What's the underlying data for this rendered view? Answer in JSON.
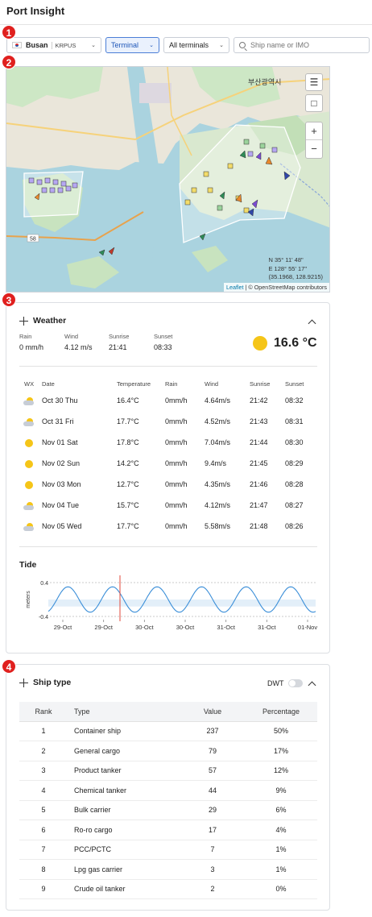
{
  "page": {
    "title": "Port Insight"
  },
  "badges": [
    "1",
    "2",
    "3",
    "4"
  ],
  "toolbar": {
    "port_name": "Busan",
    "port_code": "KRPUS",
    "terminal_label": "Terminal",
    "all_terminals_label": "All terminals",
    "search_placeholder": "Ship name or IMO"
  },
  "map": {
    "city_label": "부산광역시",
    "coords_line1": "N 35° 11' 48\"",
    "coords_line2": "E 128° 55' 17\"",
    "coords_line3": "(35.1968, 128.9215)",
    "attribution_leaflet": "Leaflet",
    "attribution_rest": "| © OpenStreetMap contributors",
    "road_label": "58"
  },
  "weather": {
    "title": "Weather",
    "current": {
      "rain_label": "Rain",
      "rain": "0 mm/h",
      "wind_label": "Wind",
      "wind": "4.12 m/s",
      "sunrise_label": "Sunrise",
      "sunrise": "21:41",
      "sunset_label": "Sunset",
      "sunset": "08:33",
      "temperature": "16.6 °C"
    },
    "forecast_headers": {
      "wx": "WX",
      "date": "Date",
      "temp": "Temperature",
      "rain": "Rain",
      "wind": "Wind",
      "sunrise": "Sunrise",
      "sunset": "Sunset"
    },
    "forecast": [
      {
        "icon": "partly-cloudy-icon",
        "date": "Oct 30 Thu",
        "temp": "16.4°C",
        "rain": "0mm/h",
        "wind": "4.64m/s",
        "sunrise": "21:42",
        "sunset": "08:32"
      },
      {
        "icon": "partly-cloudy-icon",
        "date": "Oct 31 Fri",
        "temp": "17.7°C",
        "rain": "0mm/h",
        "wind": "4.52m/s",
        "sunrise": "21:43",
        "sunset": "08:31"
      },
      {
        "icon": "sun-icon",
        "date": "Nov 01 Sat",
        "temp": "17.8°C",
        "rain": "0mm/h",
        "wind": "7.04m/s",
        "sunrise": "21:44",
        "sunset": "08:30"
      },
      {
        "icon": "sun-icon",
        "date": "Nov 02 Sun",
        "temp": "14.2°C",
        "rain": "0mm/h",
        "wind": "9.4m/s",
        "sunrise": "21:45",
        "sunset": "08:29"
      },
      {
        "icon": "sun-icon",
        "date": "Nov 03 Mon",
        "temp": "12.7°C",
        "rain": "0mm/h",
        "wind": "4.35m/s",
        "sunrise": "21:46",
        "sunset": "08:28"
      },
      {
        "icon": "partly-cloudy-icon",
        "date": "Nov 04 Tue",
        "temp": "15.7°C",
        "rain": "0mm/h",
        "wind": "4.12m/s",
        "sunrise": "21:47",
        "sunset": "08:27"
      },
      {
        "icon": "partly-cloudy-icon",
        "date": "Nov 05 Wed",
        "temp": "17.7°C",
        "rain": "0mm/h",
        "wind": "5.58m/s",
        "sunrise": "21:48",
        "sunset": "08:26"
      }
    ]
  },
  "tide": {
    "title": "Tide",
    "chart_data": {
      "type": "line",
      "ylabel": "meters",
      "ylim": [
        -0.4,
        0.4
      ],
      "yticks": [
        "0.4",
        "-0.4"
      ],
      "xticks": [
        "29-Oct",
        "29-Oct",
        "30-Oct",
        "30-Oct",
        "31-Oct",
        "31-Oct",
        "01-Nov"
      ],
      "series": [
        {
          "amplitude": 0.3,
          "cycles": 6.0
        }
      ]
    }
  },
  "ship_type": {
    "title": "Ship type",
    "dwt_label": "DWT",
    "headers": {
      "rank": "Rank",
      "type": "Type",
      "value": "Value",
      "percentage": "Percentage"
    },
    "rows": [
      {
        "rank": "1",
        "type": "Container ship",
        "value": "237",
        "percentage": "50%"
      },
      {
        "rank": "2",
        "type": "General cargo",
        "value": "79",
        "percentage": "17%"
      },
      {
        "rank": "3",
        "type": "Product tanker",
        "value": "57",
        "percentage": "12%"
      },
      {
        "rank": "4",
        "type": "Chemical tanker",
        "value": "44",
        "percentage": "9%"
      },
      {
        "rank": "5",
        "type": "Bulk carrier",
        "value": "29",
        "percentage": "6%"
      },
      {
        "rank": "6",
        "type": "Ro-ro cargo",
        "value": "17",
        "percentage": "4%"
      },
      {
        "rank": "7",
        "type": "PCC/PCTC",
        "value": "7",
        "percentage": "1%"
      },
      {
        "rank": "8",
        "type": "Lpg gas carrier",
        "value": "3",
        "percentage": "1%"
      },
      {
        "rank": "9",
        "type": "Crude oil tanker",
        "value": "2",
        "percentage": "0%"
      }
    ]
  }
}
